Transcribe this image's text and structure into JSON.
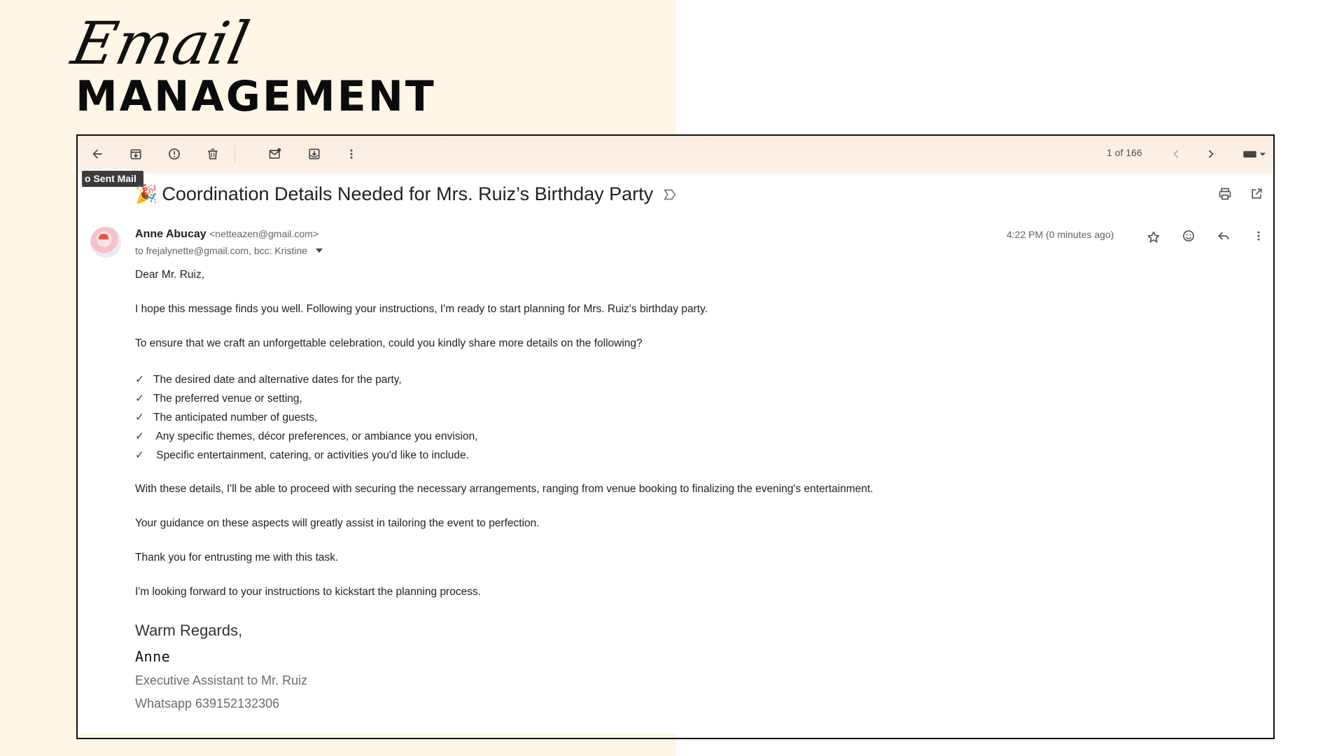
{
  "page": {
    "script_word": "Email",
    "headline": "MANAGEMENT"
  },
  "toolbar": {
    "pager": "1 of 166",
    "tooltip": "o Sent Mail",
    "icons": [
      "back-arrow-icon",
      "archive-icon",
      "report-spam-icon",
      "delete-icon",
      "mark-unread-icon",
      "move-to-icon",
      "more-vert-icon",
      "chevron-left-icon",
      "chevron-right-icon",
      "keyboard-icon"
    ]
  },
  "email": {
    "subject_emoji": "🎉",
    "subject": "Coordination Details Needed for Mrs. Ruiz’s Birthday Party",
    "sender_name": "Anne Abucay",
    "sender_email": "<netteazen@gmail.com>",
    "recipients": "to frejalynette@gmail.com, bcc: Kristine",
    "time": "4:22 PM (0 minutes ago)",
    "greeting": "Dear Mr. Ruiz,",
    "para1": "I hope this message finds you well. Following your instructions, I'm ready to start planning for Mrs. Ruiz's birthday party.",
    "para2": "To ensure that we craft an unforgettable celebration, could you kindly share more details on the following?",
    "checklist": [
      "The desired date and alternative dates for the party,",
      "The preferred venue or setting,",
      "The anticipated number of guests,",
      " Any specific themes, décor preferences, or ambiance you envision,",
      " Specific entertainment, catering, or activities you'd like to include."
    ],
    "check_mark": "✓",
    "para3": "With these details, I'll be able to proceed with securing the necessary arrangements, ranging from venue booking to finalizing the evening's entertainment.",
    "para4": "Your guidance on these aspects will greatly assist in tailoring the event to perfection.",
    "para5": "Thank you for entrusting me with this task.",
    "para6": "I'm looking forward to your instructions to kickstart the planning process.",
    "sig_closing": "Warm Regards,",
    "sig_name": "Anne",
    "sig_title": "Executive Assistant to Mr. Ruiz",
    "sig_phone": "Whatsapp 639152132306"
  },
  "colors": {
    "cream": "#fff6e6",
    "toolbar": "#fbece0",
    "frame_border": "#111111"
  }
}
